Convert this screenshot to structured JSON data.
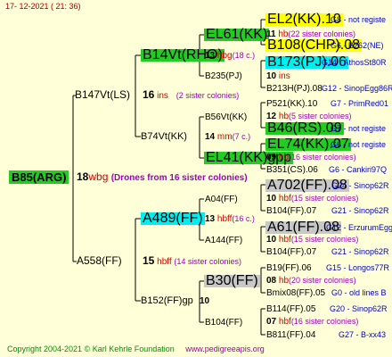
{
  "header": "17-  12-2021  (  21:  36)",
  "footer": {
    "copyright": "Copyright 2004-2021 © Karl Kehrle Foundation",
    "url": "www.pedigreeapis.org"
  },
  "root": {
    "name": "B85(ARG)",
    "num": "18",
    "sub": "wbg",
    "note": "(Drones from 16 sister colonies)"
  },
  "gen1": [
    {
      "name": "B147Vt(LS)",
      "num": "16",
      "sub": "ins",
      "note": "(2 sister colonies)"
    },
    {
      "name": "A558(FF)",
      "num": "15",
      "sub": "hbff",
      "note": "(14 sister colonies)"
    }
  ],
  "gen2": [
    {
      "name": "B14Vt(RHO)",
      "num": "13",
      "sub": "hbg",
      "note": "(18 c.)"
    },
    {
      "name": "B74Vt(KK)",
      "num": "14",
      "sub": "mm",
      "note": "(7 c.)"
    },
    {
      "name": "A489(FF)",
      "num": "13",
      "sub": "hbff",
      "note": "(16 c.)"
    },
    {
      "name": "B152(FF)gp",
      "num": "10",
      "sub": "",
      "note": ""
    }
  ],
  "gen3": [
    {
      "name": "EL61(KK)"
    },
    {
      "name": "B235(PJ)"
    },
    {
      "name": "B56Vt(KK)"
    },
    {
      "name": "EL41(KK)gpp"
    },
    {
      "name": "A04(FF)"
    },
    {
      "name": "A144(FF)"
    },
    {
      "name": "B30(FF)"
    },
    {
      "name": "B104(FF)"
    }
  ],
  "gen4": [
    {
      "name": "EL2(KK).10",
      "gl": "G8 - not registe"
    },
    {
      "num": "11",
      "sub": "hb",
      "note": "(22 sister colonies)"
    },
    {
      "name": "B108(CHP).08",
      "gl": "G6 - B262(NE)"
    },
    {
      "name": "B173(PJ).06",
      "gl": "G14 - AthosSt80R"
    },
    {
      "num": "10",
      "sub": "ins",
      "note": ""
    },
    {
      "name": "B213H(PJ).08",
      "gl": "G12 - SinopEgg86R"
    },
    {
      "name": "P521(KK).10",
      "gl": "G7 - PrimRed01"
    },
    {
      "num": "12",
      "sub": "hb",
      "note": "(5 sister colonies)"
    },
    {
      "name": "B46(RS).09",
      "gl": "G7 - not registe"
    },
    {
      "name": "EL74(KK).07",
      "gl": "G6 - not registe"
    },
    {
      "num": "09",
      "sub": "hb",
      "note": "(16 sister colonies)"
    },
    {
      "name": "B351(CS).06",
      "gl": "G6 - Cankiri97Q"
    },
    {
      "name": "A702(FF).08",
      "gl": "G24 - Sinop62R"
    },
    {
      "num": "10",
      "sub": "hbf",
      "note": "(15 sister colonies)"
    },
    {
      "name": "B104(FF).07",
      "gl": "G21 - Sinop62R"
    },
    {
      "name": "A61(FF).08",
      "gl": "G12 - ErzurumEgg8"
    },
    {
      "num": "10",
      "sub": "hbf",
      "note": "(15 sister colonies)"
    },
    {
      "name": "B104(FF).07",
      "gl": "G21 - Sinop62R"
    },
    {
      "name": "B19(FF).06",
      "gl": "G15 - Longos77R"
    },
    {
      "num": "08",
      "sub": "hb",
      "note": "(20 sister colonies)"
    },
    {
      "name": "Bmix08(FF).05",
      "gl": "G0 - old lines B"
    },
    {
      "name": "B114(FF).05",
      "gl": "G20 - Sinop62R"
    },
    {
      "num": "07",
      "sub": "hbf",
      "note": "(16 sister colonies)"
    },
    {
      "name": "B811(FF).04",
      "gl": "G27 - B-xx43"
    }
  ]
}
